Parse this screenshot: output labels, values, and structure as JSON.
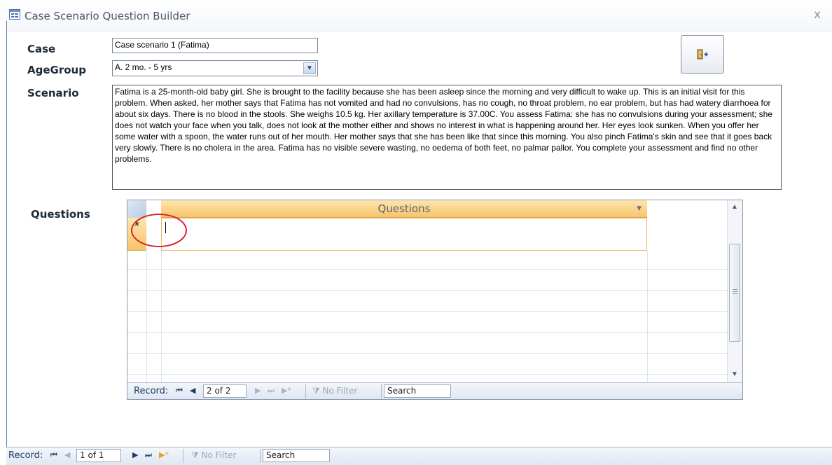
{
  "window": {
    "title": "Case Scenario Question Builder",
    "close_glyph": "x"
  },
  "form": {
    "case_label": "Case",
    "case_value": "Case scenario 1 (Fatima)",
    "agegroup_label": "AgeGroup",
    "agegroup_value": "A. 2 mo. - 5 yrs",
    "scenario_label": "Scenario",
    "scenario_text": "Fatima is a 25-month-old baby girl. She is brought to the facility because she has been asleep since the morning and very difficult to wake up. This is an initial visit for this problem. When asked, her mother says that Fatima has not vomited and had no convulsions, has no cough, no throat problem, no ear problem, but has had watery diarrhoea for about six days. There is no blood in the stools. She weighs 10.5 kg. Her axillary temperature is 37.00C. You assess Fatima: she has no convulsions during your assessment; she does not watch your face when you talk, does not look at the mother either and shows no interest in what is happening around her. Her eyes look sunken. When you offer her some water with a spoon, the water runs out of her mouth. Her mother says that she has been like that since this morning. You also pinch Fatima's skin and see that it goes back very slowly. There is no cholera in the area. Fatima has no visible severe wasting, no oedema of both feet, no palmar pallor. You complete your assessment and find no other problems.",
    "questions_label": "Questions",
    "exit_icon": "exit-door-icon"
  },
  "subform": {
    "column_header": "Questions",
    "new_record_marker": "*",
    "nav": {
      "record_label": "Record:",
      "current": "2 of 2",
      "filter_label": "No Filter",
      "search_label": "Search"
    }
  },
  "main_nav": {
    "record_label": "Record:",
    "current": "1 of 1",
    "filter_label": "No Filter",
    "search_label": "Search"
  },
  "colors": {
    "header_accent": "#f7c46b",
    "annotation_circle": "#d8232a",
    "frame_blue": "#5d7ea6"
  }
}
